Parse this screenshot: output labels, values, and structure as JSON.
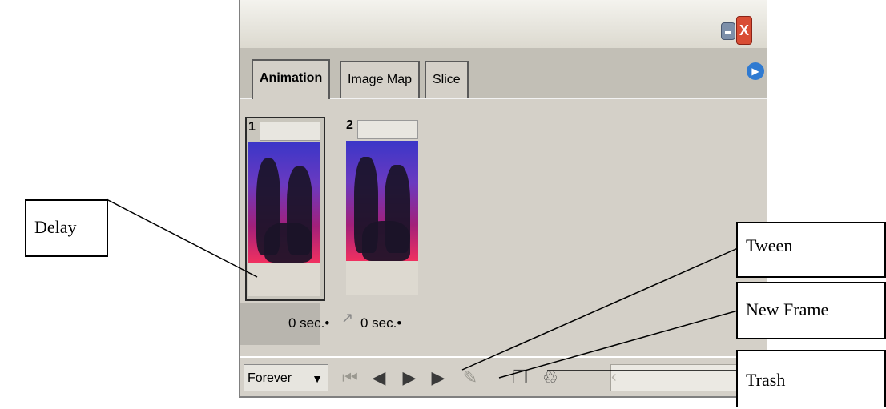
{
  "window": {
    "close_glyph": "X"
  },
  "tabs": [
    {
      "label": "Animation",
      "active": true
    },
    {
      "label": "Image Map",
      "active": false
    },
    {
      "label": "Slice",
      "active": false
    }
  ],
  "frames": [
    {
      "number": "1",
      "delay": "0 sec.•",
      "selected": true
    },
    {
      "number": "2",
      "delay": "0 sec.•",
      "selected": false
    }
  ],
  "toolbar": {
    "loop_value": "Forever",
    "loop_arrow": "▼",
    "buttons": [
      {
        "name": "first-frame-icon",
        "glyph": "⏮",
        "enabled": false
      },
      {
        "name": "previous-frame-icon",
        "glyph": "◀",
        "enabled": true
      },
      {
        "name": "play-icon",
        "glyph": "▶",
        "enabled": true
      },
      {
        "name": "next-frame-icon",
        "glyph": "▶",
        "enabled": true
      },
      {
        "name": "tween-icon",
        "glyph": "✎",
        "enabled": false
      },
      {
        "name": "new-frame-icon",
        "glyph": "❐",
        "enabled": true
      },
      {
        "name": "trash-icon",
        "glyph": "♲",
        "enabled": true
      }
    ]
  },
  "callouts": {
    "delay": "Delay",
    "tween": "Tween",
    "new_frame": "New Frame",
    "trash": "Trash"
  }
}
